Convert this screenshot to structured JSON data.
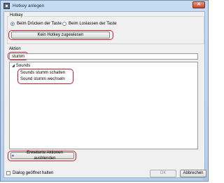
{
  "window": {
    "title": "Hotkey anlegen",
    "close_glyph": "✕",
    "app_icon": "hotkey-icon"
  },
  "hotkey": {
    "group_label": "Hotkey",
    "radio_press": "Beim Drücken der Taste",
    "radio_release": "Beim Loslassen der Taste",
    "selected": "press",
    "assign_button": "Kein Hotkey zugewiesen"
  },
  "action": {
    "group_label": "Aktion",
    "search_value": "stumm",
    "tree": {
      "category": "Sounds",
      "items": [
        "Sounds stumm schalten",
        "Sound stumm wechseln"
      ]
    },
    "toggle_button": "Erweiterte Aktionen ausblenden",
    "toggle_glyph": "▲"
  },
  "footer": {
    "keep_open_label": "Dialog geöffnet halten",
    "keep_open_checked": false,
    "ok": "OK",
    "cancel": "Abbrechen"
  },
  "colors": {
    "highlight": "#c8202a",
    "frame": "#b6cfeb"
  }
}
